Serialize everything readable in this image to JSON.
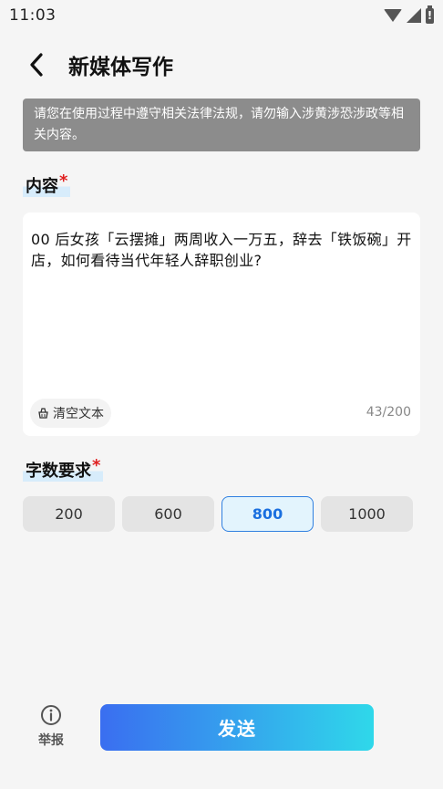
{
  "status": {
    "time": "11:03"
  },
  "header": {
    "title": "新媒体写作"
  },
  "notice": "请您在使用过程中遵守相关法律法规，请勿输入涉黄涉恐涉政等相关内容。",
  "content_section": {
    "label": "内容",
    "required": "*",
    "text": "00 后女孩「云摆摊」两周收入一万五，辞去「铁饭碗」开店，如何看待当代年轻人辞职创业?",
    "clear_label": "清空文本",
    "counter": "43/200"
  },
  "length_section": {
    "label": "字数要求",
    "required": "*",
    "options": [
      "200",
      "600",
      "800",
      "1000"
    ],
    "selected": "800"
  },
  "footer": {
    "report_label": "举报",
    "send_label": "发送"
  }
}
